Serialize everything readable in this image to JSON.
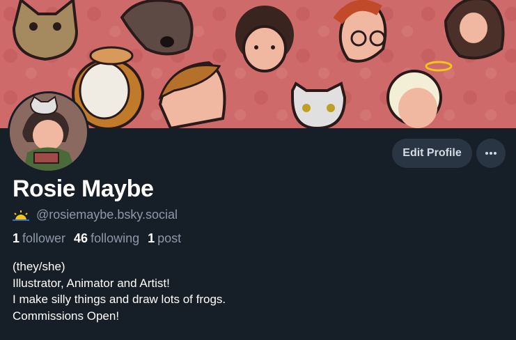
{
  "profile": {
    "display_name": "Rosie Maybe",
    "handle": "@rosiemaybe.bsky.social",
    "stats": {
      "followers_count": "1",
      "followers_label": "follower",
      "following_count": "46",
      "following_label": "following",
      "posts_count": "1",
      "posts_label": "post"
    },
    "bio": [
      "(they/she)",
      "Illustrator, Animator and Artist!",
      "I make silly things and draw lots of frogs.",
      "Commissions Open!"
    ]
  },
  "actions": {
    "edit_profile_label": "Edit Profile",
    "more_icon": "ellipsis-icon"
  },
  "colors": {
    "background": "#161e27",
    "banner": "#cf6a6a",
    "button_bg": "#2a3543",
    "secondary_text": "#8d99aa",
    "sun_emoji": "#f5c518"
  }
}
